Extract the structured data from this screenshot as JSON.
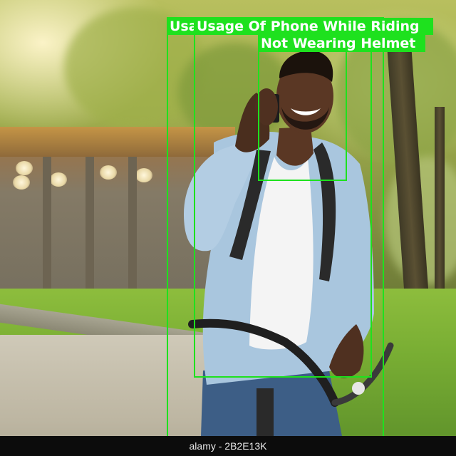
{
  "scene": {
    "description_icon": "photo",
    "colors": {
      "detection_box": "#1ee11e",
      "label_text": "#ffffff",
      "watermark_bar": "#0c0c0c"
    }
  },
  "detections": [
    {
      "label": "Usage Of Phone While Riding"
    },
    {
      "label": "Usage Of Phone While Riding"
    },
    {
      "label": "Not Wearing Helmet"
    }
  ],
  "watermark": {
    "text": "alamy - 2B2E13K"
  }
}
